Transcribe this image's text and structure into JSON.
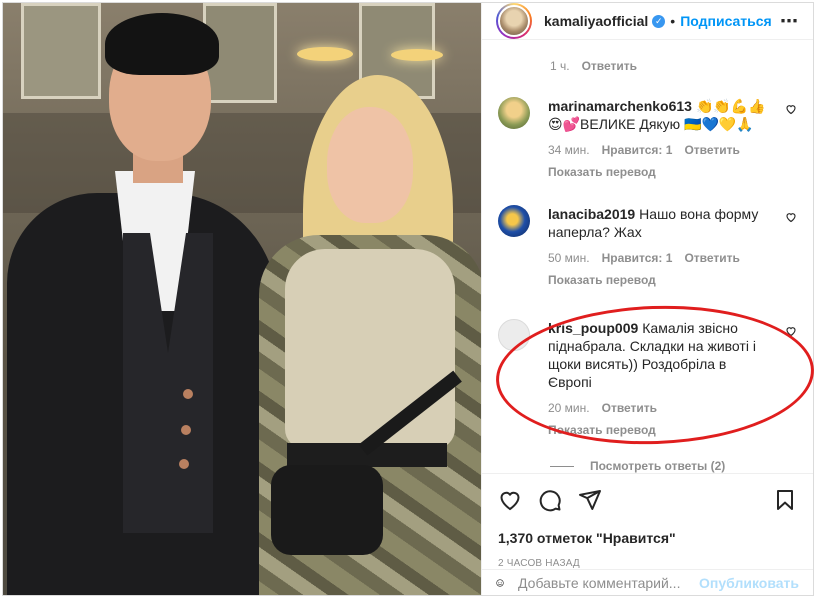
{
  "post": {
    "username": "kamaliyaofficial",
    "follow_label": "Подписаться",
    "more_icon": "more-horizontal-icon"
  },
  "top_meta": {
    "time": "1 ч.",
    "reply_label": "Ответить"
  },
  "comments": [
    {
      "username": "marinamarchenko613",
      "text_line1": "👏👏💪👍",
      "text_line2": "😍💕ВЕЛИКЕ Дякую 🇺🇦💙💛🙏",
      "time": "34 мин.",
      "likes": "Нравится: 1",
      "reply_label": "Ответить",
      "translate_label": "Показать перевод",
      "avatar_color": "#8a9a55"
    },
    {
      "username": "lanaciba2019",
      "text": "Нашо вона форму наперла? Жах",
      "time": "50 мин.",
      "likes": "Нравится: 1",
      "reply_label": "Ответить",
      "translate_label": "Показать перевод",
      "avatar_color": "#1f4fa8"
    },
    {
      "username": "kris_poup009",
      "text": "Камалія звісно піднабрала. Складки на животі і щоки висять)) Роздобріла в Європі",
      "time": "20 мин.",
      "reply_label": "Ответить",
      "translate_label": "Показать перевод",
      "view_replies_label": "Посмотреть ответы (2)",
      "avatar_color": "#e6e6e6"
    }
  ],
  "actions": {
    "likes_text": "1,370 отметок \"Нравится\"",
    "time_ago": "2 ЧАСОВ НАЗАД"
  },
  "add_comment": {
    "placeholder": "Добавьте комментарий...",
    "publish_label": "Опубликовать"
  },
  "colors": {
    "accent": "#0095f6",
    "annotation": "#e01e1e",
    "muted": "#8e8e8e"
  }
}
